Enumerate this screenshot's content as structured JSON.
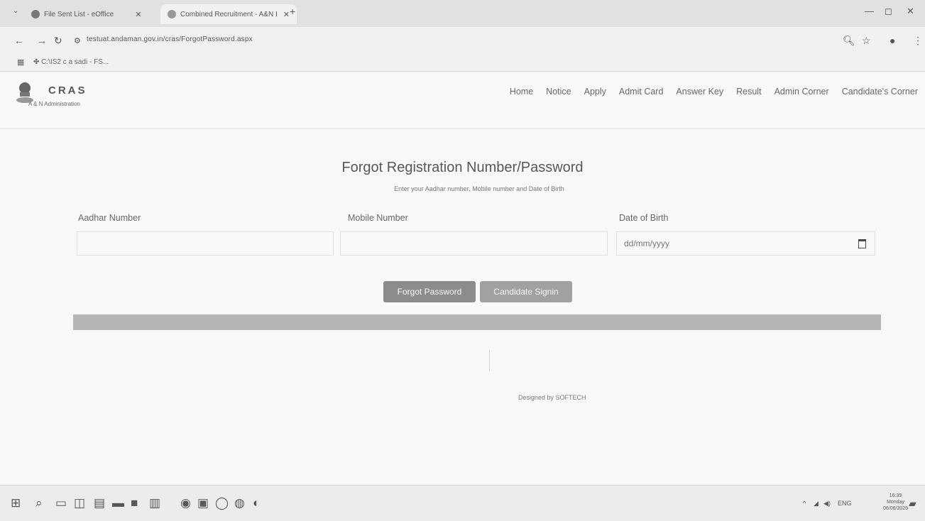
{
  "browser": {
    "tabs": [
      {
        "title": "File Sent List - eOffice"
      },
      {
        "title": "Combined Recruitment - A&N I"
      }
    ],
    "new_tab": "+",
    "address": "testuat.andaman.gov.in/cras/ForgotPassword.aspx",
    "bookmark": "C:\\IS2 c a sadi - FS..."
  },
  "brand": {
    "title": "CRAS",
    "subtitle": "A & N Administration"
  },
  "nav": {
    "items": [
      "Home",
      "Notice",
      "Apply",
      "Admit Card",
      "Answer Key",
      "Result",
      "Admin Corner",
      "Candidate's Corner"
    ]
  },
  "form": {
    "heading": "Forgot Registration Number/Password",
    "instructions": "Enter your Aadhar number, Mobile number and Date of Birth",
    "aadhar_label": "Aadhar Number",
    "mobile_label": "Mobile Number",
    "dob_label": "Date of Birth",
    "dob_placeholder": "dd/mm/yyyy",
    "forgot_button": "Forgot Password",
    "signin_button": "Candidate Signin"
  },
  "footer": {
    "designed_by": "Designed by SOFTECH"
  },
  "taskbar": {
    "language": "ENG",
    "time": "16:39",
    "day": "Monday",
    "date": "06/06/2025"
  }
}
